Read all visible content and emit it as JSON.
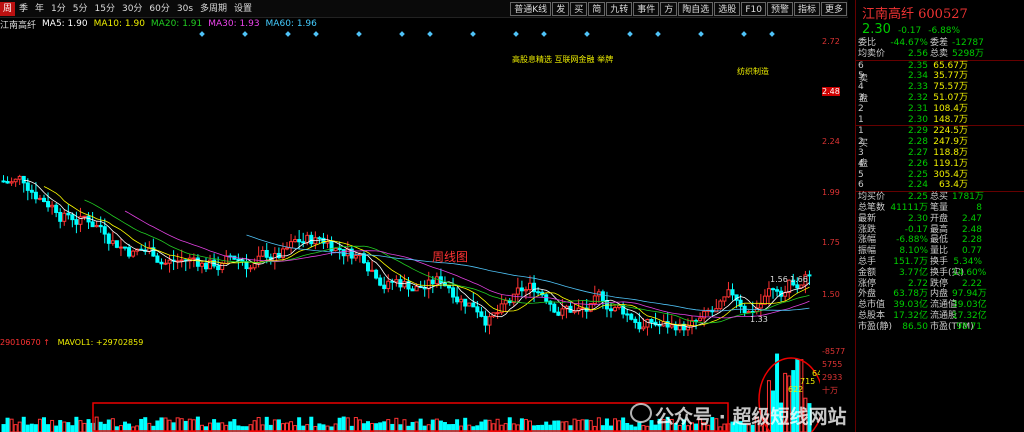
{
  "toolbar": {
    "items": [
      "周",
      "季",
      "年",
      "1分",
      "5分",
      "15分",
      "30分",
      "60分",
      "30s",
      "多周期",
      "设置"
    ],
    "active_index": 0,
    "right_items": [
      "普通K线",
      "发",
      "买",
      "简",
      "九转",
      "事件",
      "方",
      "陶自选",
      "选股",
      "F10",
      "预警",
      "指标",
      "更多"
    ]
  },
  "ma_bar": {
    "name": "江南高纤",
    "ma5": "MA5: 1.90",
    "ma10": "MA10: 1.90",
    "ma20": "MA20: 1.91",
    "ma30": "MA30: 1.93",
    "ma60": "MA60: 1.96"
  },
  "colors": {
    "ma5": "#ffffff",
    "ma10": "#ffff00",
    "ma20": "#22cc22",
    "ma30": "#e040e0",
    "ma60": "#4fc3f7",
    "up": "#ff3333",
    "down": "#00ffff"
  },
  "chart_labels": {
    "top_annot": "高股息精选  互联网金融  举牌",
    "sector": "纺织制造",
    "weekly": "周线图",
    "low_label": "1.33",
    "mid_label": "1.56",
    "mid_label2": "1.66"
  },
  "price_axis": [
    "2.72",
    "2.48",
    "2.24",
    "1.99",
    "1.75",
    "1.50"
  ],
  "volume_header": {
    "left": "29010670 ↑",
    "mavol": "MAVOL1: +29702859"
  },
  "volume_axis": [
    "-8577",
    "5755",
    "2933",
    "十万"
  ],
  "volume_annots": [
    "622",
    "715",
    "643"
  ],
  "panel": {
    "title": "江南高纤 600527",
    "price": "2.30",
    "change": "-0.17",
    "pct": "-6.88%",
    "summary": [
      {
        "k": "委比",
        "v": "-44.67%",
        "k2": "委差",
        "v2": "-12787"
      },
      {
        "k": "均卖价",
        "v": "2.56",
        "k2": "总卖",
        "v2": "5298万"
      }
    ],
    "asks": [
      {
        "lv": "6",
        "p": "2.35",
        "q": "65.67万"
      },
      {
        "lv": "5",
        "p": "2.34",
        "q": "35.77万"
      },
      {
        "lv": "4",
        "p": "2.33",
        "q": "75.57万"
      },
      {
        "lv": "3",
        "p": "2.32",
        "q": "51.07万"
      },
      {
        "lv": "2",
        "p": "2.31",
        "q": "108.4万"
      },
      {
        "lv": "1",
        "p": "2.30",
        "q": "148.7万"
      }
    ],
    "bids": [
      {
        "lv": "1",
        "p": "2.29",
        "q": "224.5万"
      },
      {
        "lv": "2",
        "p": "2.28",
        "q": "247.9万"
      },
      {
        "lv": "3",
        "p": "2.27",
        "q": "118.8万"
      },
      {
        "lv": "4",
        "p": "2.26",
        "q": "119.1万"
      },
      {
        "lv": "5",
        "p": "2.25",
        "q": "305.4万"
      },
      {
        "lv": "6",
        "p": "2.24",
        "q": "63.4万"
      }
    ],
    "ask_side": "卖盘",
    "bid_side": "买盘",
    "stats": [
      {
        "k": "均买价",
        "v": "2.25",
        "k2": "总买",
        "v2": "1781万"
      },
      {
        "k": "总笔数",
        "v": "41111万",
        "k2": "笔量",
        "v2": "8"
      },
      {
        "k": "最新",
        "v": "2.30",
        "k2": "开盘",
        "v2": "2.47"
      },
      {
        "k": "涨跌",
        "v": "-0.17",
        "k2": "最高",
        "v2": "2.48"
      },
      {
        "k": "涨幅",
        "v": "-6.88%",
        "k2": "最低",
        "v2": "2.28"
      },
      {
        "k": "振幅",
        "v": "8.10%",
        "k2": "量比",
        "v2": "0.77"
      },
      {
        "k": "总手",
        "v": "151.7万",
        "k2": "换手",
        "v2": "5.34%"
      },
      {
        "k": "金额",
        "v": "3.77亿",
        "k2": "换手(实)",
        "v2": "14.60%"
      },
      {
        "k": "涨停",
        "v": "2.72",
        "k2": "跌停",
        "v2": "2.22"
      },
      {
        "k": "外盘",
        "v": "63.78万",
        "k2": "内盘",
        "v2": "97.94万"
      },
      {
        "k": "总市值",
        "v": "39.03亿",
        "k2": "流通值",
        "v2": "39.03亿"
      },
      {
        "k": "总股本",
        "v": "17.32亿",
        "k2": "流通股",
        "v2": "17.32亿"
      },
      {
        "k": "市盈(静)",
        "v": "86.50",
        "k2": "市盈(TTM)",
        "v2": "98.71"
      }
    ]
  },
  "watermark": "公众号 · 超级短线网站"
}
